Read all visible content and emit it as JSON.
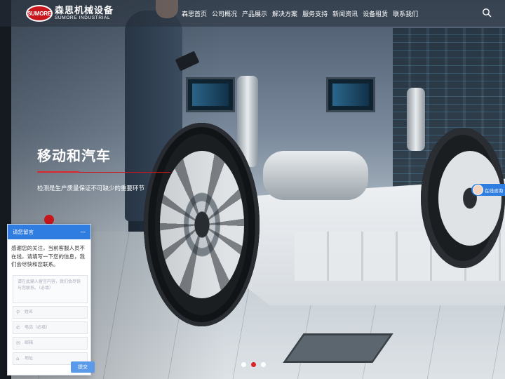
{
  "brand": {
    "logo_mark": "SUMORE",
    "name_cn": "森思机械设备",
    "name_en": "SUMORE INDUSTRIAL",
    "accent_color": "#c8161d"
  },
  "nav": {
    "items": [
      {
        "label": "森思首页"
      },
      {
        "label": "公司概况"
      },
      {
        "label": "产品展示"
      },
      {
        "label": "解决方案"
      },
      {
        "label": "服务支持"
      },
      {
        "label": "新闻资讯"
      },
      {
        "label": "设备租赁"
      },
      {
        "label": "联系我们"
      }
    ],
    "search_icon": "search-icon"
  },
  "hero": {
    "title": "移动和汽车",
    "subtitle": "检测是生产质量保证不可缺少的重要环节",
    "slide_count": 3,
    "active_slide": 2
  },
  "consult": {
    "label": "在线咨询",
    "color": "#2f7de1"
  },
  "chat": {
    "title": "请您留言",
    "minimize": "—",
    "intro": "感谢您的关注，当前客服人员不在线，请填写一下您的信息，我们会尽快和您联系。",
    "message_placeholder": "请在此输入留言内容，我们会尽快与您联系。（必填）",
    "fields": [
      {
        "icon": "user-icon",
        "glyph": "⚲",
        "placeholder": "姓名"
      },
      {
        "icon": "phone-icon",
        "glyph": "✆",
        "placeholder": "电话（必填）"
      },
      {
        "icon": "mail-icon",
        "glyph": "✉",
        "placeholder": "邮箱"
      },
      {
        "icon": "location-icon",
        "glyph": "⌂",
        "placeholder": "地址"
      }
    ],
    "submit_label": "提交",
    "header_color": "#2f7de1"
  }
}
